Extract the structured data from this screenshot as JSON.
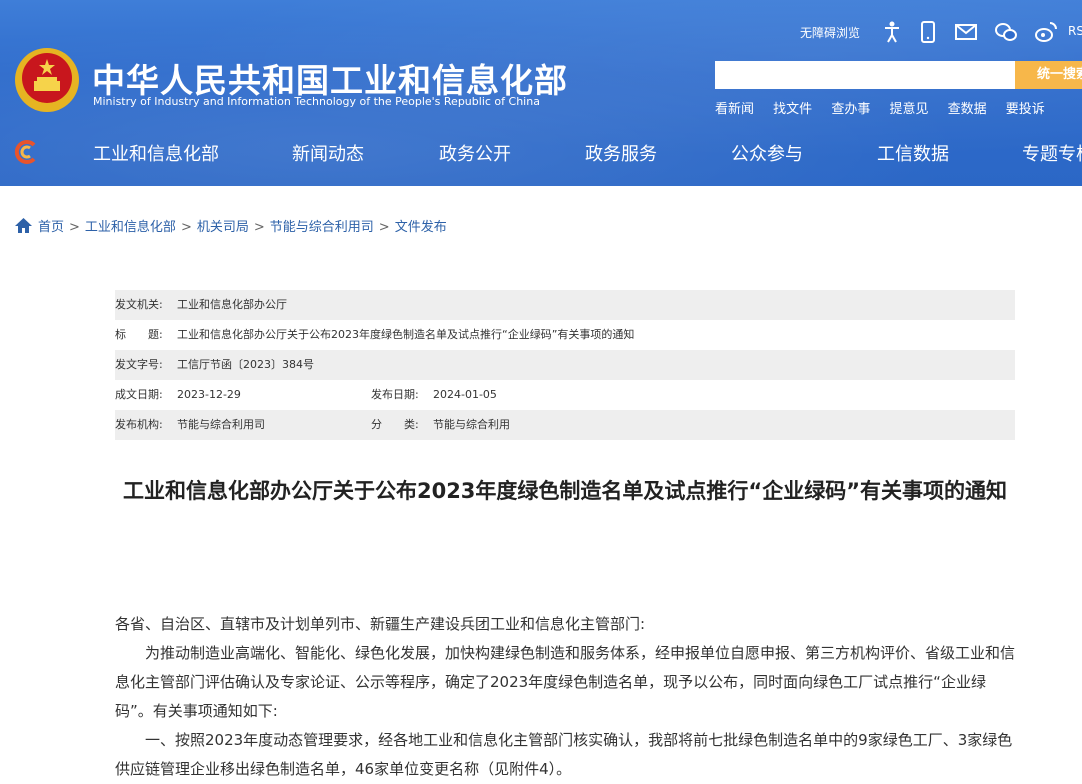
{
  "header": {
    "title_cn": "中华人民共和国工业和信息化部",
    "title_en": "Ministry of Industry and Information Technology of the People's Republic of China",
    "accessibility_label": "无障碍浏览",
    "rss_label": "RSS",
    "search": {
      "placeholder": "",
      "button_label": "统一搜索"
    },
    "quicklinks": [
      "看新闻",
      "找文件",
      "查办事",
      "提意见",
      "查数据",
      "要投诉"
    ],
    "nav": [
      "工业和信息化部",
      "新闻动态",
      "政务公开",
      "政务服务",
      "公众参与",
      "工信数据",
      "专题专栏"
    ]
  },
  "breadcrumb": [
    "首页",
    "工业和信息化部",
    "机关司局",
    "节能与综合利用司",
    "文件发布"
  ],
  "meta": {
    "issuer_label": "发文机关:",
    "issuer": "工业和信息化部办公厅",
    "title_label": "标　　题:",
    "title": "工业和信息化部办公厅关于公布2023年度绿色制造名单及试点推行“企业绿码”有关事项的通知",
    "docno_label": "发文字号:",
    "docno": "工信厅节函〔2023〕384号",
    "created_label": "成文日期:",
    "created": "2023-12-29",
    "published_label": "发布日期:",
    "published": "2024-01-05",
    "agency_label": "发布机构:",
    "agency": "节能与综合利用司",
    "category_label": "分　　类:",
    "category": "节能与综合利用"
  },
  "document": {
    "title": "工业和信息化部办公厅关于公布2023年度绿色制造名单及试点推行“企业绿码”有关事项的通知",
    "salutation": "各省、自治区、直辖市及计划单列市、新疆生产建设兵团工业和信息化主管部门:",
    "para1": "为推动制造业高端化、智能化、绿色化发展，加快构建绿色制造和服务体系，经申报单位自愿申报、第三方机构评价、省级工业和信息化主管部门评估确认及专家论证、公示等程序，确定了2023年度绿色制造名单，现予以公布，同时面向绿色工厂试点推行“企业绿码”。有关事项通知如下:",
    "para2": "一、按照2023年度动态管理要求，经各地工业和信息化主管部门核实确认，我部将前七批绿色制造名单中的9家绿色工厂、3家绿色供应链管理企业移出绿色制造名单，46家单位变更名称（见附件4）。"
  }
}
